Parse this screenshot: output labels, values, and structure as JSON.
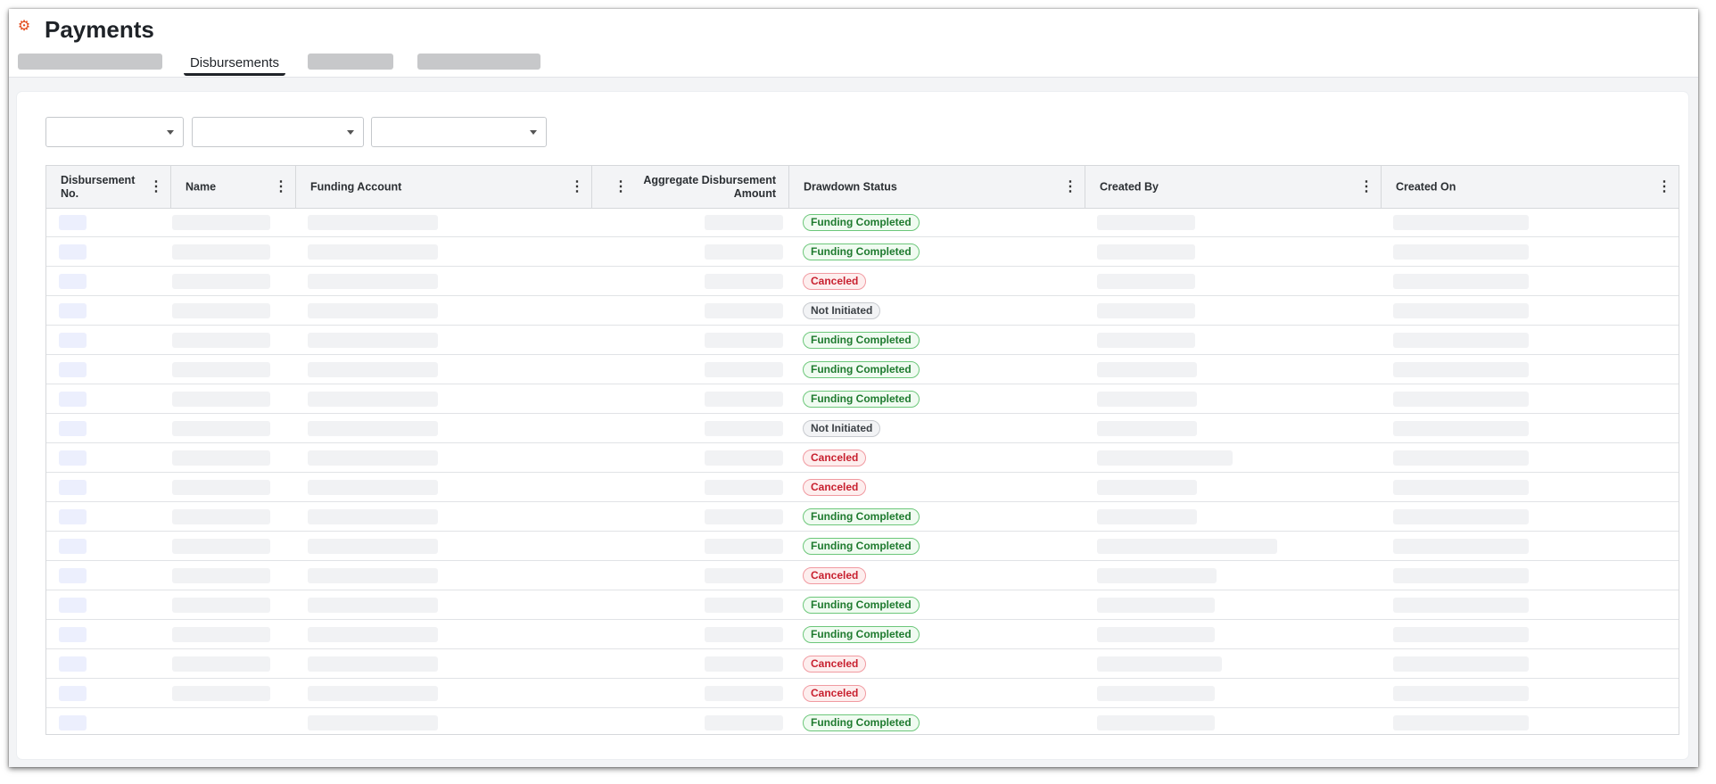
{
  "app": {
    "icon": "gear-icon",
    "title": "Payments",
    "accent_color": "#e24a1a"
  },
  "tabs": {
    "active_label": "Disbursements"
  },
  "filters": [
    {
      "value": ""
    },
    {
      "value": ""
    },
    {
      "value": ""
    }
  ],
  "grid": {
    "columns": [
      {
        "label": "Disbursement No."
      },
      {
        "label": "Name"
      },
      {
        "label": "Funding Account"
      },
      {
        "label": ""
      },
      {
        "label": "Aggregate Disbursement Amount"
      },
      {
        "label": "Drawdown Status"
      },
      {
        "label": "Created By"
      },
      {
        "label": "Created On"
      }
    ],
    "status_colors": {
      "green": "#1e7a2e",
      "red": "#c8202f",
      "gray": "#3c4146"
    },
    "rows": [
      {
        "status": "Funding Completed",
        "tone": "green"
      },
      {
        "status": "Funding Completed",
        "tone": "green"
      },
      {
        "status": "Canceled",
        "tone": "red"
      },
      {
        "status": "Not Initiated",
        "tone": "gray"
      },
      {
        "status": "Funding Completed",
        "tone": "green"
      },
      {
        "status": "Funding Completed",
        "tone": "green"
      },
      {
        "status": "Funding Completed",
        "tone": "green"
      },
      {
        "status": "Not Initiated",
        "tone": "gray"
      },
      {
        "status": "Canceled",
        "tone": "red"
      },
      {
        "status": "Canceled",
        "tone": "red"
      },
      {
        "status": "Funding Completed",
        "tone": "green"
      },
      {
        "status": "Funding Completed",
        "tone": "green"
      },
      {
        "status": "Canceled",
        "tone": "red"
      },
      {
        "status": "Funding Completed",
        "tone": "green"
      },
      {
        "status": "Funding Completed",
        "tone": "green"
      },
      {
        "status": "Canceled",
        "tone": "red"
      },
      {
        "status": "Canceled",
        "tone": "red"
      },
      {
        "status": "Funding Completed",
        "tone": "green"
      }
    ]
  }
}
